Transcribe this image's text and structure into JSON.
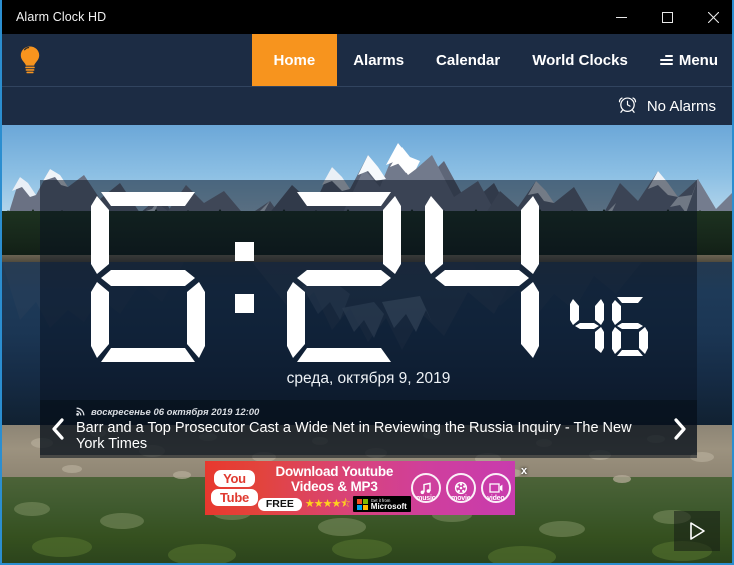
{
  "window": {
    "title": "Alarm Clock HD",
    "controls": [
      {
        "name": "minimize",
        "label": "–"
      },
      {
        "name": "maximize",
        "label": "□"
      },
      {
        "name": "close",
        "label": "✕"
      }
    ]
  },
  "nav": {
    "logo_icon": "lightbulb-icon",
    "accent_color": "#f7941e",
    "bar_color": "#1c2c44",
    "items": [
      {
        "label": "Home",
        "active": true
      },
      {
        "label": "Alarms",
        "active": false
      },
      {
        "label": "Calendar",
        "active": false
      },
      {
        "label": "World Clocks",
        "active": false
      }
    ],
    "menu_label": "Menu",
    "menu_icon": "hamburger-menu-icon"
  },
  "alarm_status": {
    "icon": "alarm-clock-icon",
    "text": "No Alarms"
  },
  "clock": {
    "time": "6:24",
    "hours": "6",
    "minutes": "24",
    "separator": ":",
    "seconds": "46",
    "date": "среда, октября 9, 2019"
  },
  "news": {
    "prev_icon": "chevron-left-icon",
    "next_icon": "chevron-right-icon",
    "feed_icon": "rss-icon",
    "timestamp": "воскресенье 06 октября 2019 12:00",
    "headline": "Barr and a Top Prosecutor Cast a Wide Net in Reviewing the Russia Inquiry - The New York Times"
  },
  "ad": {
    "brand_top": "You",
    "brand_bottom": "Tube",
    "line1": "Download Youtube",
    "line2": "Videos & MP3",
    "free_label": "FREE",
    "stars": "★★★★⯪",
    "store_small": "Get it from",
    "store_name": "Microsoft",
    "icons": [
      {
        "caption": "music",
        "glyph": "♫"
      },
      {
        "caption": "movie",
        "glyph": "✸"
      },
      {
        "caption": "video",
        "glyph": "▶"
      }
    ],
    "close_label": "x"
  },
  "player": {
    "play_icon": "play-icon"
  }
}
